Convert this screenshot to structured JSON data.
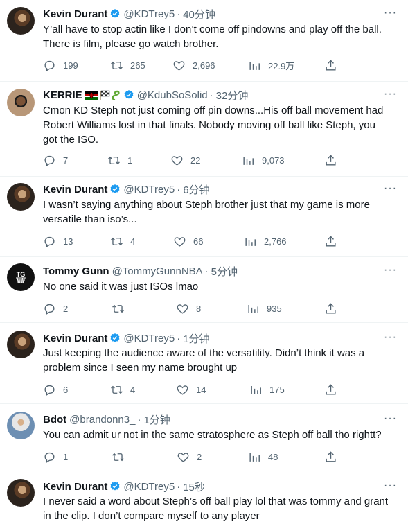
{
  "tweets": [
    {
      "name": "Kevin Durant",
      "handle": "@KDTrey5",
      "time": "40分钟",
      "lines": [
        "Y’all have to stop actin like I don’t come off pindowns and play off the ball.",
        "There is film, please go watch brother."
      ],
      "replies": "199",
      "retweets": "265",
      "likes": "2,696",
      "views": "22.9万"
    },
    {
      "name": "KERRIE",
      "handle": "@KdubSoSolid",
      "time": "32分钟",
      "lines": [
        "Cmon KD Steph not just coming off pin downs...His off ball movement had",
        "Robert Williams lost in that finals. Nobody moving off ball like Steph, you",
        "got the ISO."
      ],
      "replies": "7",
      "retweets": "1",
      "likes": "22",
      "views": "9,073"
    },
    {
      "name": "Kevin Durant",
      "handle": "@KDTrey5",
      "time": "6分钟",
      "lines": [
        "I wasn’t saying anything about Steph brother just that my game is more",
        "versatile than iso’s..."
      ],
      "replies": "13",
      "retweets": "4",
      "likes": "66",
      "views": "2,766"
    },
    {
      "name": "Tommy Gunn",
      "handle": "@TommyGunnNBA",
      "time": "5分钟",
      "lines": [
        "No one said it was just ISOs lmao"
      ],
      "replies": "2",
      "retweets": "",
      "likes": "8",
      "views": "935"
    },
    {
      "name": "Kevin Durant",
      "handle": "@KDTrey5",
      "time": "1分钟",
      "lines": [
        "Just keeping the audience aware of the versatility. Didn’t think it was a",
        "problem since I seen my name brought up"
      ],
      "replies": "6",
      "retweets": "4",
      "likes": "14",
      "views": "175"
    },
    {
      "name": "Bdot",
      "handle": "@brandonn3_",
      "time": "1分钟",
      "lines": [
        "You can admit ur not in the same stratosphere as Steph off ball tho rightt?"
      ],
      "replies": "1",
      "retweets": "",
      "likes": "2",
      "views": "48"
    },
    {
      "name": "Kevin Durant",
      "handle": "@KDTrey5",
      "time": "15秒",
      "lines": [
        "I never said a word about Steph’s off ball play lol that was tommy and grant",
        "in the clip. I don’t compare myself to any player"
      ]
    }
  ],
  "colors": {
    "verified": "#1d9bf0",
    "secondary": "#536471",
    "text": "#0f1419",
    "divider": "#eff3f4"
  },
  "icons": [
    "reply-icon",
    "retweet-icon",
    "like-icon",
    "views-icon",
    "share-icon",
    "verified-icon",
    "more-icon"
  ]
}
